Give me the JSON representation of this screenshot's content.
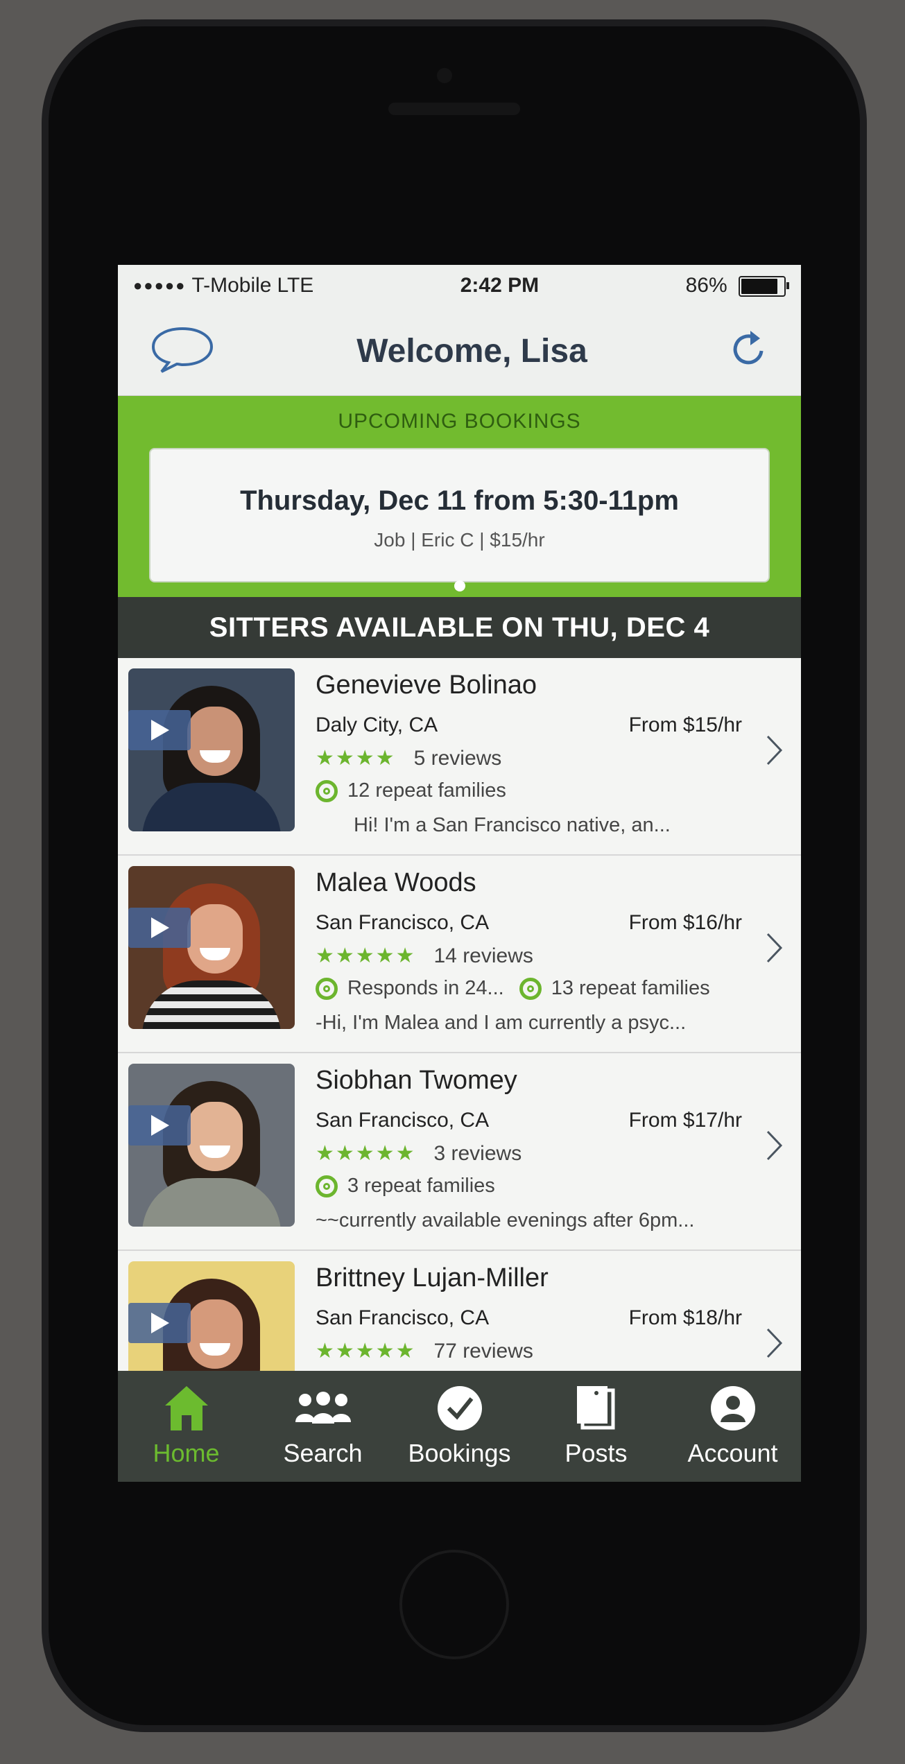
{
  "status": {
    "dots": "●●●●●",
    "carrier": "T-Mobile",
    "network": "LTE",
    "time": "2:42 PM",
    "battery": "86%"
  },
  "nav": {
    "title": "Welcome, Lisa"
  },
  "upcoming": {
    "label": "UPCOMING BOOKINGS",
    "date": "Thursday, Dec 11 from 5:30-11pm",
    "meta": "Job | Eric C | $15/hr"
  },
  "sitters_header": "SITTERS AVAILABLE ON THU, DEC 4",
  "sitters": [
    {
      "name": "Genevieve Bolinao",
      "city": "Daly City, CA",
      "price": "From $15/hr",
      "stars": "★★★★",
      "reviews": "5 reviews",
      "badge1": "12 repeat families",
      "badge2": "",
      "bio": "Hi! I'm a San Francisco native, an..."
    },
    {
      "name": "Malea Woods",
      "city": "San Francisco, CA",
      "price": "From $16/hr",
      "stars": "★★★★★",
      "reviews": "14 reviews",
      "badge1": "Responds in 24...",
      "badge2": "13 repeat families",
      "bio": "-Hi, I'm Malea and I am currently a psyc..."
    },
    {
      "name": "Siobhan Twomey",
      "city": "San Francisco, CA",
      "price": "From $17/hr",
      "stars": "★★★★★",
      "reviews": "3 reviews",
      "badge1": "3 repeat families",
      "badge2": "",
      "bio": "~~currently available evenings after 6pm..."
    },
    {
      "name": "Brittney Lujan-Miller",
      "city": "San Francisco, CA",
      "price": "From $18/hr",
      "stars": "★★★★★",
      "reviews": "77 reviews",
      "badge1": "",
      "badge2": "",
      "bio": ""
    }
  ],
  "tabs": {
    "home": "Home",
    "search": "Search",
    "bookings": "Bookings",
    "posts": "Posts",
    "account": "Account"
  },
  "colors": {
    "accent": "#6cbb2f",
    "header_bg": "#353a36",
    "tabbar_bg": "#3b413c"
  },
  "icons": {
    "left_nav": "chat-bubble-icon",
    "right_nav": "refresh-icon",
    "play": "play-icon",
    "chevron": "chevron-right-icon"
  }
}
